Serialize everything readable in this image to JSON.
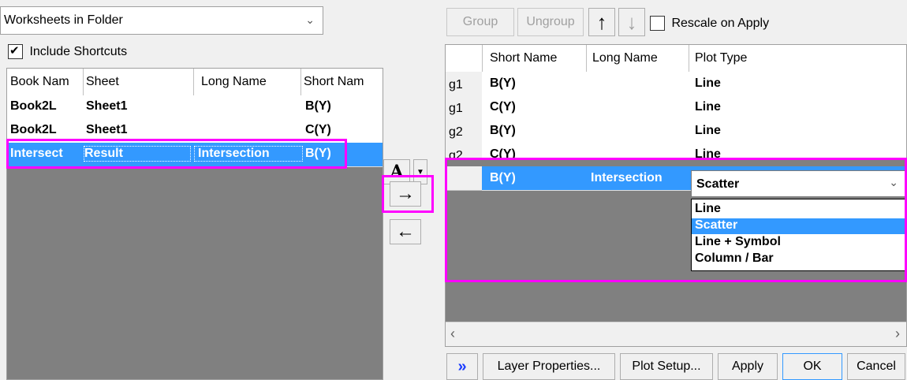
{
  "source_combo": {
    "value": "Worksheets in Folder"
  },
  "include_shortcuts": {
    "label": "Include Shortcuts",
    "checked": true
  },
  "left_table": {
    "headers": [
      "Book Nam",
      "Sheet",
      "Long Name",
      "Short Nam"
    ],
    "rows": [
      [
        "Book2L",
        "Sheet1",
        "",
        "B(Y)"
      ],
      [
        "Book2L",
        "Sheet1",
        "",
        "C(Y)"
      ],
      [
        "Intersect",
        "Result",
        "Intersection",
        "B(Y)"
      ]
    ]
  },
  "middle": {
    "text_label": "A",
    "add_icon": "→",
    "remove_icon": "←"
  },
  "toolbar": {
    "group_label": "Group",
    "ungroup_label": "Ungroup",
    "up_icon": "🢁",
    "rescale_label": "Rescale on Apply"
  },
  "right_table": {
    "headers": [
      "Short Name",
      "Long Name",
      "Plot Type"
    ],
    "rows": [
      {
        "group": "g1",
        "cells": [
          "B(Y)",
          "",
          "Line"
        ]
      },
      {
        "group": "g1",
        "cells": [
          "C(Y)",
          "",
          "Line"
        ]
      },
      {
        "group": "g2",
        "cells": [
          "B(Y)",
          "",
          "Line"
        ]
      },
      {
        "group": "g2",
        "cells": [
          "C(Y)",
          "",
          "Line"
        ]
      },
      {
        "group": "",
        "cells": [
          "B(Y)",
          "Intersection",
          ""
        ]
      }
    ],
    "plot_type_dropdown": {
      "selected": "Scatter",
      "options": [
        "Line",
        "Scatter",
        "Line + Symbol",
        "Column / Bar"
      ]
    }
  },
  "bottom_buttons": {
    "expand": "»",
    "layer_properties": "Layer Properties...",
    "plot_setup": "Plot Setup...",
    "apply": "Apply",
    "ok": "OK",
    "cancel": "Cancel"
  },
  "colors": {
    "highlight": "#ff00ff",
    "selection": "#3399ff",
    "grid_bg": "#808080"
  }
}
